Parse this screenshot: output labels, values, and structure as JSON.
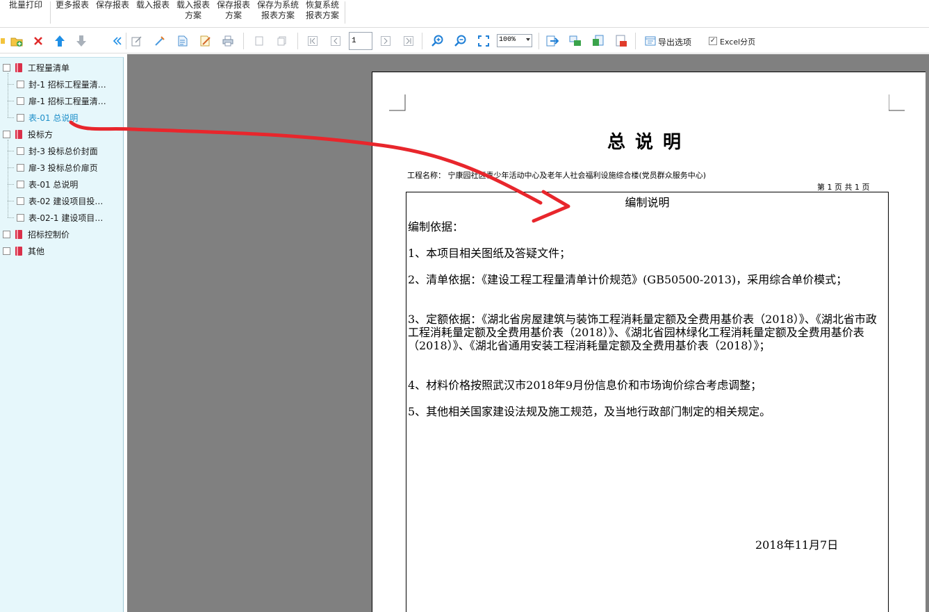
{
  "ribbon": {
    "batch_print": "批量打印",
    "more_reports": "更多报表",
    "save_report": "保存报表",
    "load_report": "载入报表",
    "load_scheme": [
      "载入报表",
      "方案"
    ],
    "save_scheme": [
      "保存报表",
      "方案"
    ],
    "save_sys_scheme": [
      "保存为系统",
      "报表方案"
    ],
    "restore_sys_scheme": [
      "恢复系统",
      "报表方案"
    ]
  },
  "toolbar": {
    "page_number": "1",
    "zoom": "100%",
    "export_options": "导出选项",
    "excel_paging": "Excel分页",
    "excel_paging_checked": true
  },
  "tree": {
    "groups": [
      {
        "label": "工程量清单",
        "children": [
          "封-1 招标工程量清…",
          "扉-1 招标工程量清…",
          "表-01 总说明"
        ]
      },
      {
        "label": "投标方",
        "children": [
          "封-3 投标总价封面",
          "扉-3 投标总价扉页",
          "表-01 总说明",
          "表-02 建设项目投…",
          "表-02-1 建设项目…"
        ]
      },
      {
        "label": "招标控制价",
        "children": []
      },
      {
        "label": "其他",
        "children": []
      }
    ],
    "selected_label_color": "#1e8fc9"
  },
  "document": {
    "title": "总说明",
    "project_label": "工程名称：",
    "project_name": "宁康园社区青少年活动中心及老年人社会福利设施综合楼(党员群众服务中心)",
    "page_info": "第 1 页 共 1 页",
    "subtitle": "编制说明",
    "basis_heading": "编制依据：",
    "items": [
      "1、本项目相关图纸及答疑文件；",
      "2、清单依据：《建设工程工程量清单计价规范》(GB50500-2013)，采用综合单价模式；",
      "3、定额依据：《湖北省房屋建筑与装饰工程消耗量定额及全费用基价表（2018）》、《湖北省市政工程消耗量定额及全费用基价表（2018）》、《湖北省园林绿化工程消耗量定额及全费用基价表（2018）》、《湖北省通用安装工程消耗量定额及全费用基价表（2018）》；",
      "4、材料价格按照武汉市2018年9月份信息价和市场询价综合考虑调整；",
      "5、其他相关国家建设法规及施工规范，及当地行政部门制定的相关规定。"
    ],
    "date": "2018年11月7日"
  },
  "colors": {
    "tree_bg": "#e6f7fb",
    "preview_bg": "#808080",
    "annotation": "#e8262c"
  }
}
